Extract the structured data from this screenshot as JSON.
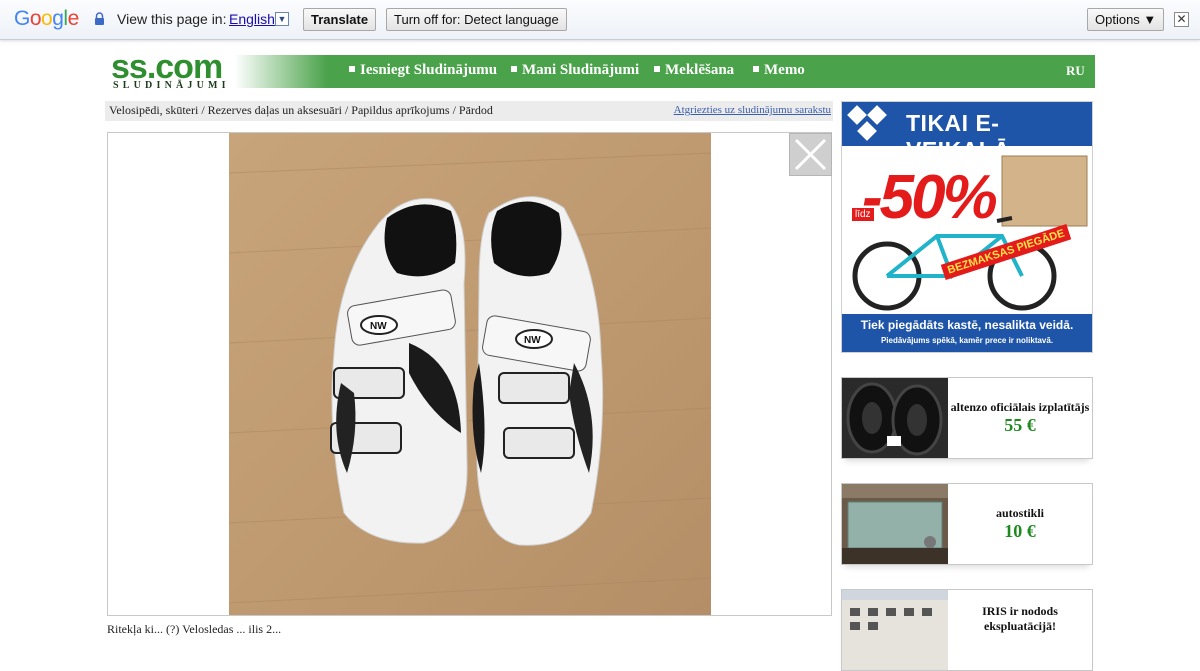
{
  "translate_bar": {
    "logo": [
      "G",
      "o",
      "o",
      "g",
      "l",
      "e"
    ],
    "logo_colors": [
      "#4285f4",
      "#ea4335",
      "#fbbc05",
      "#4285f4",
      "#34a853",
      "#ea4335"
    ],
    "prompt": "View this page in:",
    "language": "English",
    "dropdown_glyph": "▼",
    "translate_label": "Translate",
    "turn_off_label": "Turn off for: Detect language",
    "options_label": "Options ▼",
    "close_glyph": "✕"
  },
  "header": {
    "logo": "ss.com",
    "logo_sub": "SLUDINĀJUMI",
    "nav": [
      "Iesniegt Sludinājumu",
      "Mani Sludinājumi",
      "Meklēšana",
      "Memo"
    ],
    "lang": "RU",
    "accent": "#4aa24a"
  },
  "breadcrumb": {
    "path": "Velosipēdi, skūteri / Rezerves daļas un aksesuāri / Papildus aprīkojums / Pārdod",
    "back_link": "Atgriezties uz sludinājumu sarakstu"
  },
  "listing": {
    "image_icon": "white-cycling-shoes-photo",
    "below_text": "Ritekļa ki... (?) Velosledas ... ilis 2..."
  },
  "banner": {
    "head": "TIKAI E-VEIKALĀ",
    "lidz": "līdz",
    "big": "-50%",
    "stamp": "BEZMAKSAS PIEGĀDE",
    "foot1": "Tiek piegādāts kastē, nesalikta veidā.",
    "foot2": "Piedāvājums spēkā, kamēr prece ir noliktavā."
  },
  "ads": [
    {
      "title": "altenzo oficiālais izplatītājs",
      "price": "55 €",
      "icon": "tires-photo"
    },
    {
      "title": "autostikli",
      "price": "10 €",
      "icon": "windshield-glass-photo"
    },
    {
      "title": "IRIS ir nodods ekspluatācijā!",
      "price": "",
      "icon": "apartment-building-photo"
    }
  ]
}
